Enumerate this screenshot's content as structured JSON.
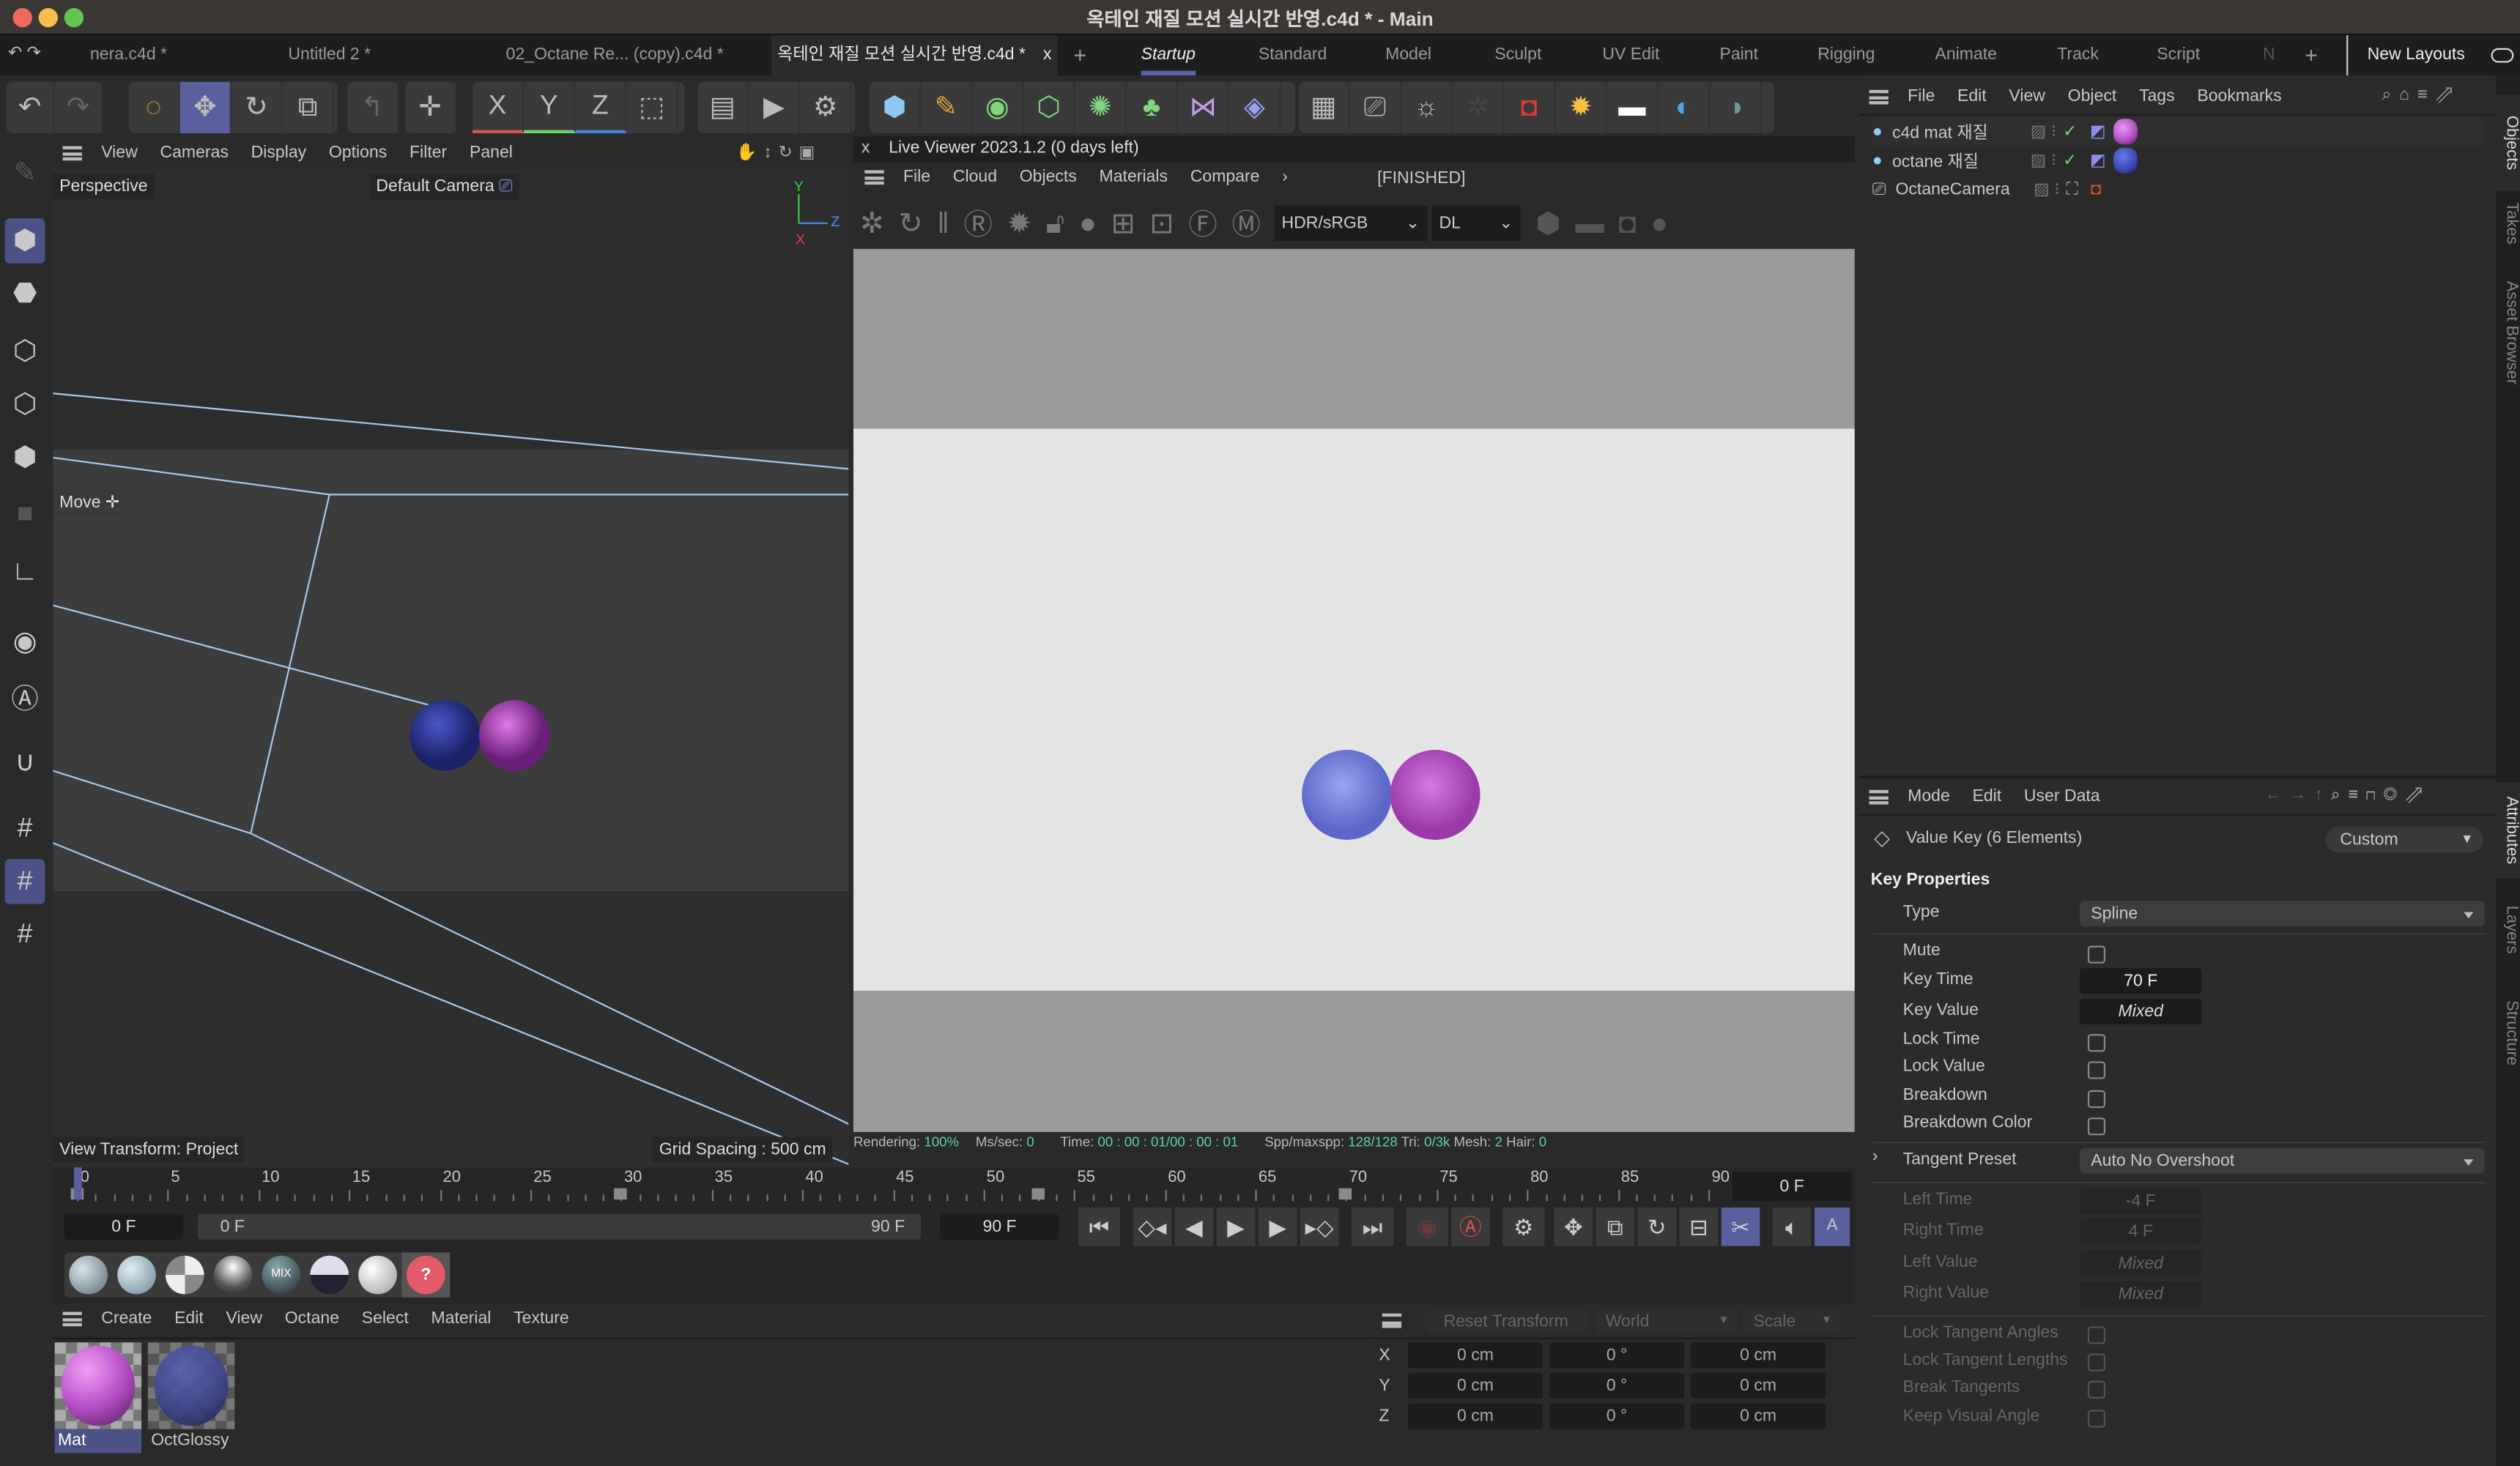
{
  "window": {
    "title": "옥테인 재질 모션 실시간 반영.c4d * - Main",
    "traffic_lights": {
      "close": "#ee6a5f",
      "minimize": "#f5be4f",
      "zoom": "#62c655"
    }
  },
  "doc_tabs": [
    {
      "label": "nera.c4d *"
    },
    {
      "label": "Untitled 2 *"
    },
    {
      "label": "02_Octane Re... (copy).c4d *"
    },
    {
      "label": "옥테인 재질 모션 실시간 반영.c4d *",
      "active": true,
      "close": "x"
    }
  ],
  "layout_tabs": [
    {
      "label": "Startup",
      "active": true
    },
    {
      "label": "Standard"
    },
    {
      "label": "Model"
    },
    {
      "label": "Sculpt"
    },
    {
      "label": "UV Edit"
    },
    {
      "label": "Paint"
    },
    {
      "label": "Rigging"
    },
    {
      "label": "Animate"
    },
    {
      "label": "Track"
    },
    {
      "label": "Script"
    },
    {
      "label": "N"
    }
  ],
  "new_layouts": "New Layouts",
  "add_symbol": "+",
  "toolbar_axis": {
    "x": "X",
    "y": "Y",
    "z": "Z",
    "x_color": "#d9534f",
    "y_color": "#6cd46c",
    "z_color": "#4a7fd9"
  },
  "viewport": {
    "menu": [
      "View",
      "Cameras",
      "Display",
      "Options",
      "Filter",
      "Panel"
    ],
    "name": "Perspective",
    "camera": "Default Camera",
    "tool": "Move",
    "view_transform": "View Transform: Project",
    "grid_spacing": "Grid Spacing : 500 cm",
    "axis": {
      "y": "Y",
      "z": "Z",
      "x": "X"
    }
  },
  "live_viewer": {
    "title": "Live Viewer 2023.1.2 (0 days left)",
    "close": "x",
    "menu": [
      "File",
      "Cloud",
      "Objects",
      "Materials",
      "Compare"
    ],
    "more": "›",
    "status": "[FINISHED]",
    "color_space": "HDR/sRGB",
    "kernel": "DL",
    "stats": [
      {
        "label": "Rendering:",
        "value": "100%"
      },
      {
        "label": "Ms/sec:",
        "value": "0"
      },
      {
        "label": "Time:",
        "value": "00 : 00 : 01/00 : 00 : 01"
      },
      {
        "label": "Spp/maxspp:",
        "value": "128/128"
      },
      {
        "label": "Tri:",
        "value": "0/3k"
      },
      {
        "label": "Mesh:",
        "value": "2"
      },
      {
        "label": "Hair:",
        "value": "0"
      }
    ]
  },
  "objects": {
    "menu": [
      "File",
      "Edit",
      "View",
      "Object",
      "Tags",
      "Bookmarks"
    ],
    "items": [
      {
        "name": "c4d mat 재질",
        "material_color": "#b04bc0"
      },
      {
        "name": "octane 재질",
        "material_color": "#3a47b0"
      },
      {
        "name": "OctaneCamera"
      }
    ]
  },
  "side_tabs": {
    "objects": "Objects",
    "takes": "Takes",
    "asset_browser": "Asset Browser",
    "attributes": "Attributes",
    "layers": "Layers",
    "structure": "Structure"
  },
  "attributes": {
    "menu": [
      "Mode",
      "Edit",
      "User Data"
    ],
    "header": "Value Key (6 Elements)",
    "preset": "Custom",
    "section": "Key Properties",
    "type_label": "Type",
    "type_value": "Spline",
    "mute": "Mute",
    "key_time": {
      "label": "Key Time",
      "value": "70 F"
    },
    "key_value": {
      "label": "Key Value",
      "value": "Mixed"
    },
    "lock_time": "Lock Time",
    "lock_value": "Lock Value",
    "breakdown": "Breakdown",
    "breakdown_color": "Breakdown Color",
    "tangent_preset": {
      "label": "Tangent Preset",
      "value": "Auto No Overshoot"
    },
    "left_time": {
      "label": "Left  Time",
      "value": "-4 F"
    },
    "right_time": {
      "label": "Right Time",
      "value": "4 F"
    },
    "left_value": {
      "label": "Left  Value",
      "value": "Mixed"
    },
    "right_value": {
      "label": "Right Value",
      "value": "Mixed"
    },
    "lock_tangent_angles": "Lock Tangent Angles",
    "lock_tangent_lengths": "Lock Tangent Lengths",
    "break_tangents": "Break Tangents",
    "keep_visual_angle": "Keep Visual Angle"
  },
  "timeline": {
    "ticks": [
      "0",
      "5",
      "10",
      "15",
      "20",
      "25",
      "30",
      "35",
      "40",
      "45",
      "50",
      "55",
      "60",
      "65",
      "70",
      "75",
      "80",
      "85",
      "90"
    ],
    "current_frame": "0 F",
    "start": "0 F",
    "range_start": "0 F",
    "range_end": "90 F",
    "end": "90 F",
    "keyframes": [
      0,
      30,
      53,
      70
    ]
  },
  "material_manager": {
    "menu": [
      "Create",
      "Edit",
      "View",
      "Octane",
      "Select",
      "Material",
      "Texture"
    ],
    "materials": [
      {
        "name": "Mat",
        "color": "#b84fc8",
        "selected": true
      },
      {
        "name": "OctGlossy",
        "color": "#3f4790"
      }
    ],
    "mix_label": "MIX"
  },
  "coordinates": {
    "reset": "Reset Transform",
    "space": "World",
    "mode": "Scale",
    "rows": [
      {
        "axis": "X",
        "pos": "0 cm",
        "rot": "0 °",
        "size": "0 cm"
      },
      {
        "axis": "Y",
        "pos": "0 cm",
        "rot": "0 °",
        "size": "0 cm"
      },
      {
        "axis": "Z",
        "pos": "0 cm",
        "rot": "0 °",
        "size": "0 cm"
      }
    ]
  }
}
